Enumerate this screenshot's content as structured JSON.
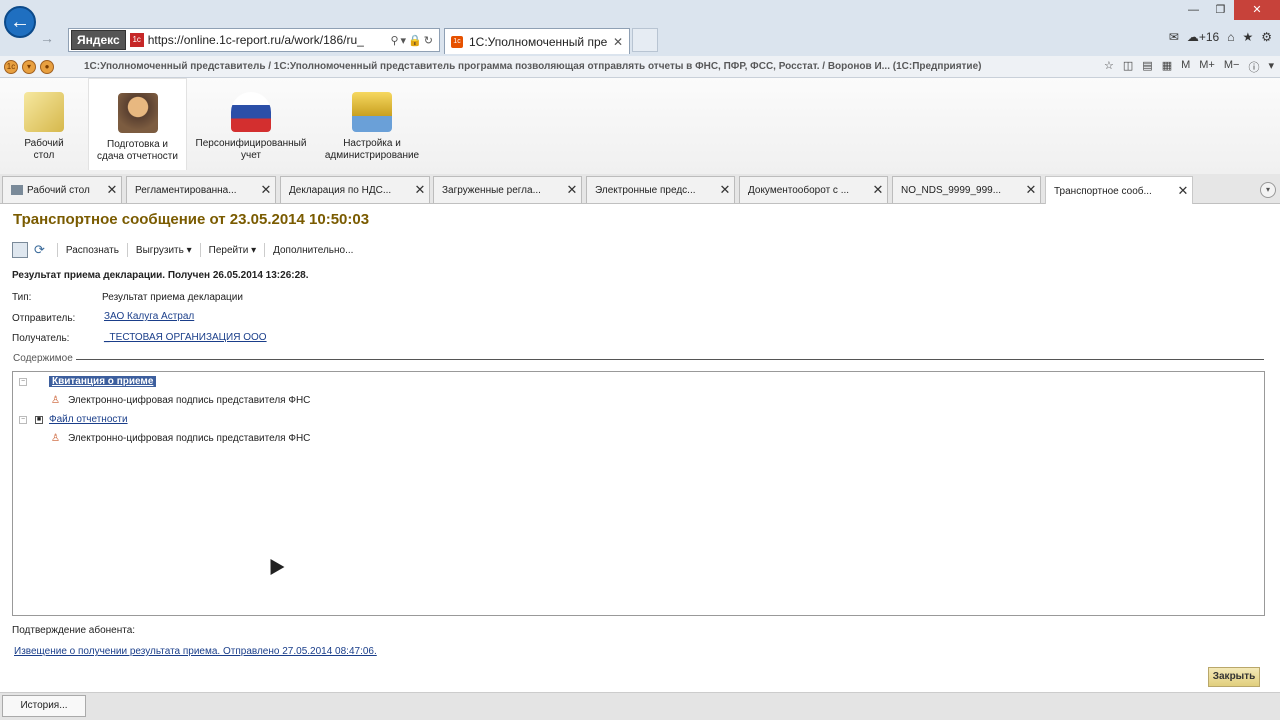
{
  "browser": {
    "yandex": "Яндекс",
    "url": "https://online.1c-report.ru/a/work/186/ru_",
    "tab_title": "1С:Уполномоченный пре...",
    "tab_close": "✕",
    "weather": "+16",
    "window_controls": [
      "—",
      "❐",
      "✕"
    ]
  },
  "command_bar": {
    "title": "1С:Уполномоченный представитель / 1С:Уполномоченный представитель программа позволяющая отправлять отчеты в ФНС, ПФР, ФСС, Росстат. / Воронов И... (1С:Предприятие)"
  },
  "sections": [
    {
      "label": "Рабочий\nстол",
      "icon": "desk-lamp-icon"
    },
    {
      "label": "Подготовка и\nсдача отчетности",
      "icon": "accountant-icon"
    },
    {
      "label": "Персонифицированный\nучет",
      "icon": "pfr-logo-icon"
    },
    {
      "label": "Настройка и\nадминистрирование",
      "icon": "database-settings-icon"
    }
  ],
  "tabs": [
    {
      "label": "Рабочий стол"
    },
    {
      "label": "Регламентированна..."
    },
    {
      "label": "Декларация по НДС..."
    },
    {
      "label": "Загруженные регла..."
    },
    {
      "label": "Электронные предс..."
    },
    {
      "label": "Документооборот с ..."
    },
    {
      "label": "NO_NDS_9999_999..."
    },
    {
      "label": "Транспортное сооб..."
    }
  ],
  "tab_close": "✕",
  "form": {
    "title": "Транспортное сообщение от 23.05.2014 10:50:03",
    "toolbar": {
      "recognize": "Распознать",
      "export": "Выгрузить",
      "goto": "Перейти",
      "more": "Дополнительно..."
    },
    "result_line": "Результат приема декларации. Получен 26.05.2014 13:26:28.",
    "type_label": "Тип:",
    "type_value": "Результат приема декларации",
    "sender_label": "Отправитель:",
    "sender_value": "ЗАО Калуга Астрал",
    "recipient_label": "Получатель:",
    "recipient_value": "_ТЕСТОВАЯ ОРГАНИЗАЦИЯ ООО",
    "contents_label": "Содержимое",
    "tree": [
      {
        "label": "Квитанция о приеме",
        "child": "Электронно-цифровая подпись представителя ФНС"
      },
      {
        "label": "Файл отчетности",
        "child": "Электронно-цифровая подпись представителя ФНС"
      }
    ],
    "confirm_label": "Подтверждение абонента:",
    "notice_link": "Извещение о получении результата приема. Отправлено 27.05.2014 08:47:06.",
    "close_button": "Закрыть"
  },
  "bottom": {
    "history_button": "История..."
  }
}
